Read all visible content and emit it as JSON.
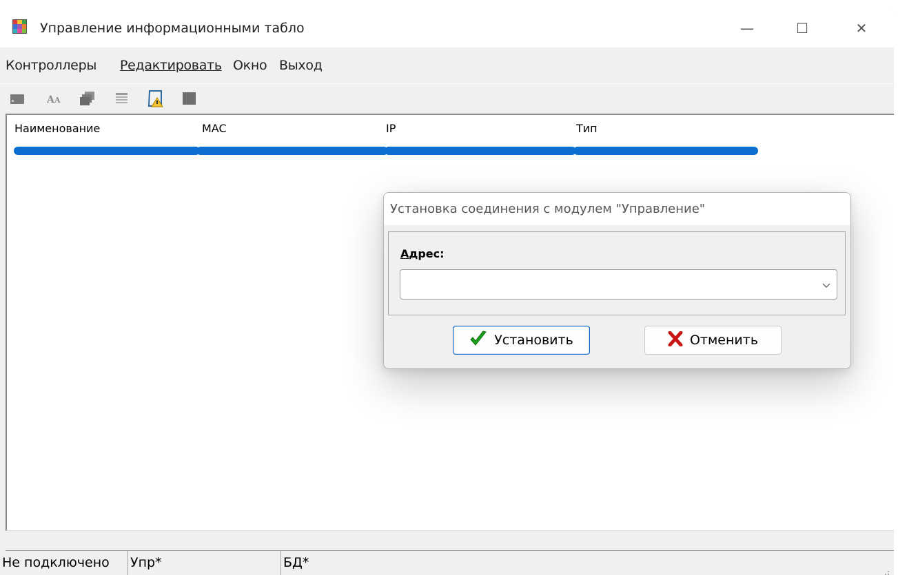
{
  "window": {
    "title": "Управление информационными табло",
    "controls": {
      "minimize": "—",
      "maximize": "☐",
      "close": "✕"
    }
  },
  "menu": {
    "items": [
      {
        "label": "Контроллеры",
        "underlined": false
      },
      {
        "label": "Редактировать",
        "underlined": true
      },
      {
        "label": "Окно",
        "underlined": false
      },
      {
        "label": "Выход",
        "underlined": false
      }
    ]
  },
  "toolbar": {
    "buttons": [
      "square-icon",
      "font-icon",
      "windows-stack-icon",
      "list-icon",
      "warning-scroll-icon",
      "grey-square-icon"
    ]
  },
  "list": {
    "columns": [
      "Наименование",
      "MAC",
      "IP",
      "Тип"
    ]
  },
  "dialog": {
    "title": "Установка соединения с модулем \"Управление\"",
    "address_label_first": "А",
    "address_label_rest": "дрес:",
    "address_value": "",
    "ok_label": "Установить",
    "cancel_label": "Отменить"
  },
  "statusbar": {
    "connection": "Не подключено",
    "control": "Упр*",
    "db": "БД*"
  },
  "colors": {
    "accent": "#0a6fd1",
    "ok_check": "#18a018",
    "cancel_x": "#c81414"
  }
}
